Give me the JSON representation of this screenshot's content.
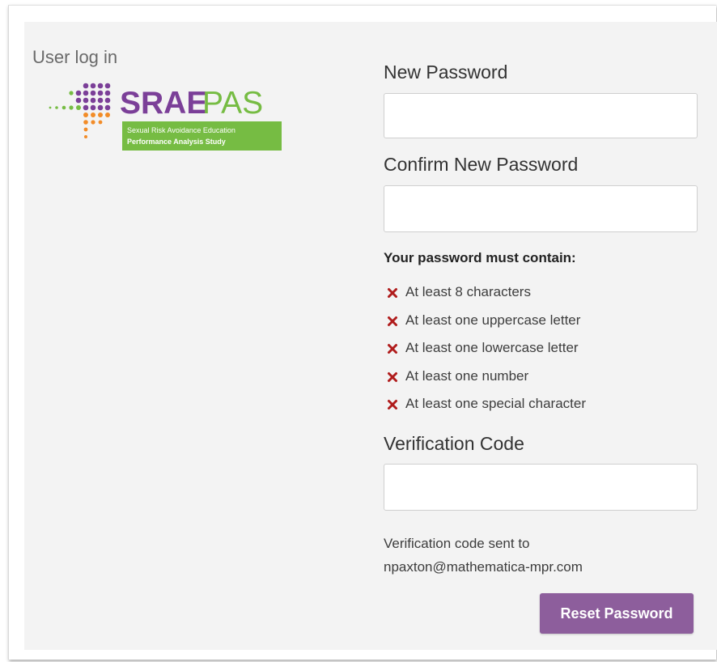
{
  "login": {
    "section_title": "User log in"
  },
  "logo": {
    "name_bold": "SRAE",
    "name_light": "PAS",
    "tagline_1": "Sexual Risk Avoidance Education",
    "tagline_2": "Performance Analysis Study",
    "colors": {
      "purple": "#7b3f98",
      "green": "#76bc43",
      "orange": "#f28c28"
    }
  },
  "form": {
    "new_password": {
      "label": "New Password",
      "value": "",
      "placeholder": ""
    },
    "confirm_password": {
      "label": "Confirm New Password",
      "value": "",
      "placeholder": ""
    },
    "requirements": {
      "heading": "Your password must contain:",
      "icon": "x-mark-icon",
      "icon_color": "#b01c1c",
      "items": [
        "At least 8 characters",
        "At least one uppercase letter",
        "At least one lowercase letter",
        "At least one number",
        "At least one special character"
      ]
    },
    "verification_code": {
      "label": "Verification Code",
      "value": "",
      "placeholder": ""
    },
    "code_note_line1": "Verification code sent to",
    "code_note_line2": "npaxton@mathematica-mpr.com",
    "submit_label": "Reset Password",
    "submit_color": "#8d5e9c"
  }
}
